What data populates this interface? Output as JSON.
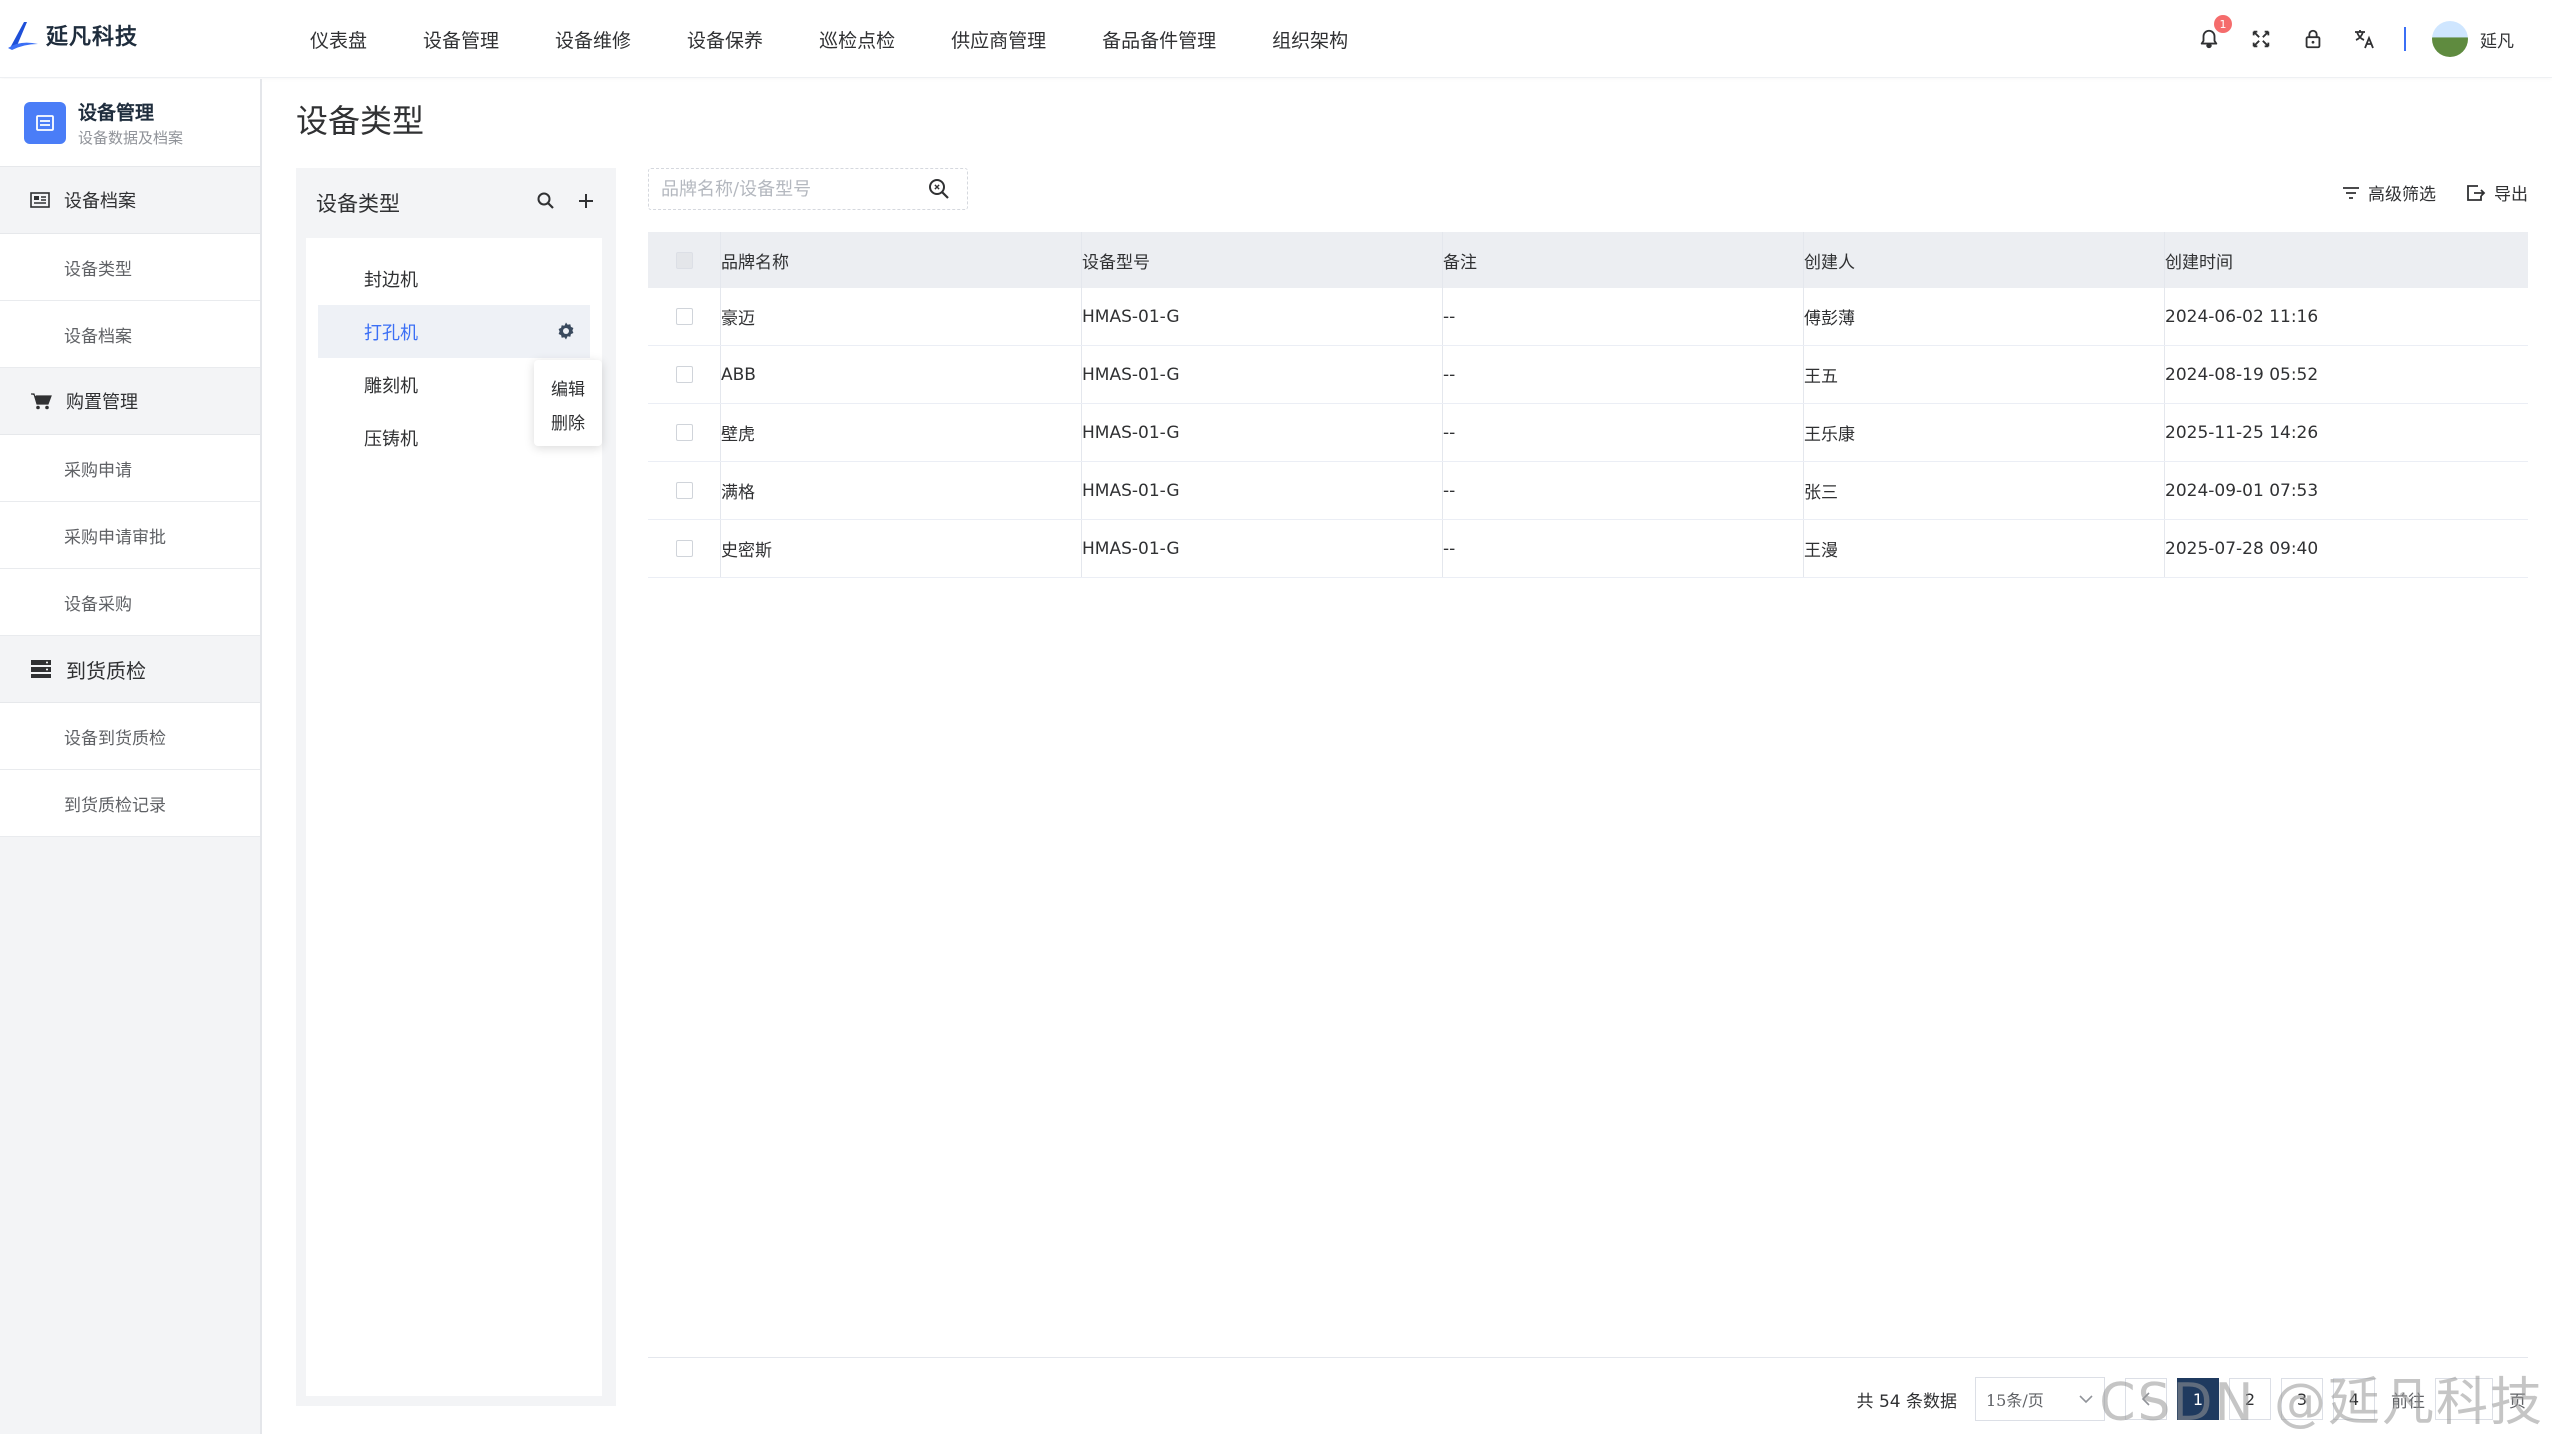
{
  "brand": {
    "name": "延凡科技"
  },
  "topnav": [
    "仪表盘",
    "设备管理",
    "设备维修",
    "设备保养",
    "巡检点检",
    "供应商管理",
    "备品备件管理",
    "组织架构"
  ],
  "header": {
    "notification_count": "1",
    "username": "延凡"
  },
  "sidebar": {
    "title": "设备管理",
    "subtitle": "设备数据及档案",
    "groups": [
      {
        "label": "设备档案",
        "icon": "archive-icon",
        "items": [
          "设备类型",
          "设备档案"
        ]
      },
      {
        "label": "购置管理",
        "icon": "cart-icon",
        "items": [
          "采购申请",
          "采购申请审批",
          "设备采购"
        ]
      },
      {
        "label": "到货质检",
        "icon": "server-icon",
        "items": [
          "设备到货质检",
          "到货质检记录"
        ]
      }
    ]
  },
  "page": {
    "title": "设备类型"
  },
  "tree": {
    "title": "设备类型",
    "nodes": [
      "封边机",
      "打孔机",
      "雕刻机",
      "压铸机"
    ],
    "active_index": 1,
    "context_menu": [
      "编辑",
      "删除"
    ]
  },
  "search": {
    "placeholder": "品牌名称/设备型号"
  },
  "toolbar": {
    "filter_label": "高级筛选",
    "export_label": "导出"
  },
  "table": {
    "columns": [
      "品牌名称",
      "设备型号",
      "备注",
      "创建人",
      "创建时间"
    ],
    "rows": [
      [
        "豪迈",
        "HMAS-01-G",
        "--",
        "傅彭薄",
        "2024-06-02 11:16"
      ],
      [
        "ABB",
        "HMAS-01-G",
        "--",
        "王五",
        "2024-08-19 05:52"
      ],
      [
        "壁虎",
        "HMAS-01-G",
        "--",
        "王乐康",
        "2025-11-25 14:26"
      ],
      [
        "满格",
        "HMAS-01-G",
        "--",
        "张三",
        "2024-09-01 07:53"
      ],
      [
        "史密斯",
        "HMAS-01-G",
        "--",
        "王漫",
        "2025-07-28 09:40"
      ]
    ]
  },
  "pagination": {
    "total": "共 54 条数据",
    "page_size": "15条/页",
    "pages": [
      "1",
      "2",
      "3",
      "4"
    ],
    "current": "1",
    "jump_prefix": "前往",
    "jump_suffix": "页"
  },
  "watermark": "CSDN @延凡科技",
  "colors": {
    "accent": "#3b6ff5",
    "active_page": "#1f3a5f",
    "badge": "#f56c6c"
  }
}
